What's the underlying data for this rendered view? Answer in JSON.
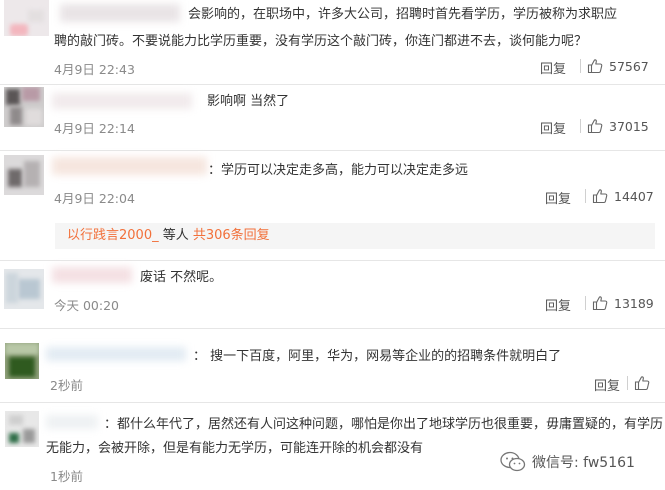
{
  "comments": [
    {
      "text_lines": [
        "会影响的，在职场中，许多大公司，招聘时首先看学历，学历被称为求职应",
        "聘的敲门砖。不要说能力比学历重要，没有学历这个敲门砖，你连门都进不去，谈何能力呢？"
      ],
      "time": "4月9日 22:43",
      "reply": "回复",
      "likes": "57567"
    },
    {
      "text": "影响啊 当然了",
      "time": "4月9日 22:14",
      "reply": "回复",
      "likes": "37015"
    },
    {
      "text": "：学历可以决定走多高，能力可以决定走多远",
      "time": "4月9日 22:04",
      "reply": "回复",
      "likes": "14407",
      "sub": {
        "user": "以行践言2000_",
        "middle": " 等人 ",
        "count": "共306条回复"
      }
    },
    {
      "text": "废话 不然呢。",
      "time": "今天 00:20",
      "reply": "回复",
      "likes": "13189"
    },
    {
      "text": "：   搜一下百度，阿里，华为，网易等企业的的招聘条件就明白了",
      "time": "2秒前",
      "reply": "回复"
    },
    {
      "text_lines": [
        "：都什么年代了，居然还有人问这种问题，哪怕是你出了地球学历也很重要，毋庸置疑的，有学历",
        "无能力，会被开除，但是有能力无学历，可能连开除的机会都没有"
      ],
      "time": "1秒前",
      "reply": "回复"
    }
  ],
  "watermark": {
    "text": "微信号: fw5161"
  },
  "colors": {
    "accent": "#f2703a",
    "meta": "#8a8a8a",
    "separator": "#e6e6e6"
  },
  "icons": [
    "avatar",
    "thumbs-up-icon",
    "wechat-icon"
  ]
}
